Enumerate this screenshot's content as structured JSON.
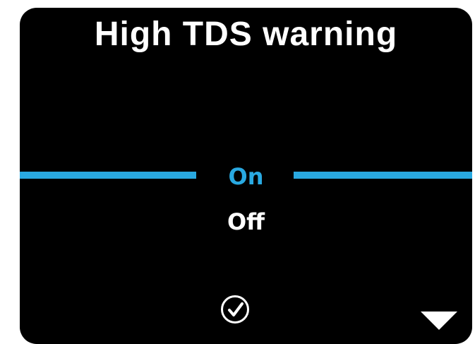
{
  "screen": {
    "title": "High TDS warning"
  },
  "options": {
    "items": [
      "On",
      "Off"
    ],
    "selected": "On"
  },
  "controls": {
    "confirm_icon": "checkmark-circle-icon",
    "down_icon": "triangle-down-icon"
  },
  "colors": {
    "background": "#000000",
    "accent": "#29a9e1",
    "text": "#ffffff"
  }
}
